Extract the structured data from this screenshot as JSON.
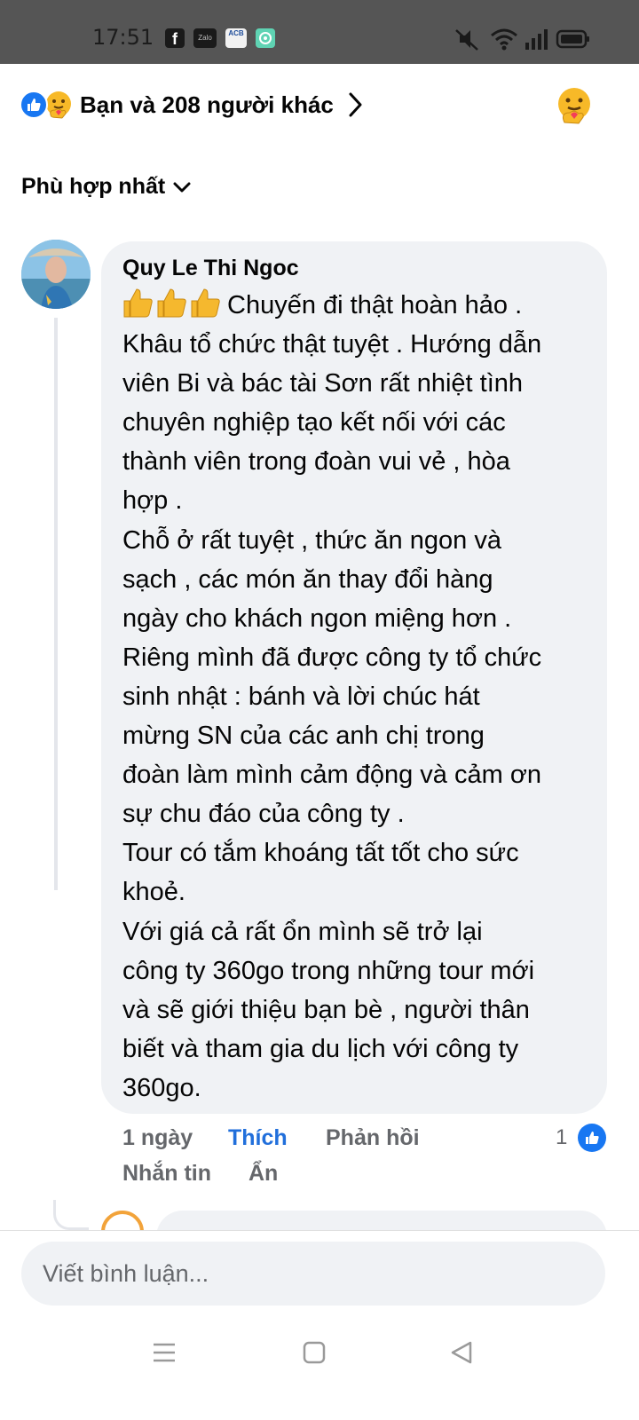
{
  "status_bar": {
    "time": "17:51",
    "apps": [
      {
        "icon": "facebook-icon",
        "label": "f"
      },
      {
        "icon": "zalo-icon",
        "label": "Zalo"
      },
      {
        "icon": "acb-icon",
        "label": "ACB"
      },
      {
        "icon": "chat-app-icon",
        "label": ""
      }
    ],
    "indicators": [
      "mute-icon",
      "wifi-icon",
      "signal-icon",
      "battery-icon"
    ]
  },
  "reactions": {
    "summary_text": "Bạn và 208 người khác",
    "types": [
      "like-icon",
      "care-icon"
    ],
    "colors": {
      "like": "#1877f2",
      "care": "#f7b928"
    }
  },
  "sort": {
    "label": "Phù hợp nhất"
  },
  "comment": {
    "author": "Quy Le Thi Ngoc",
    "emoji_prefix": "thumbs-up x3",
    "body": "Chuyến đi thật hoàn hảo .\nKhâu tổ chức thật tuyệt . Hướng dẫn\nviên Bi và bác tài Sơn rất nhiệt tình\nchuyên nghiệp tạo kết nối với các\nthành viên trong đoàn vui vẻ , hòa\nhợp .\nChỗ ở rất tuyệt , thức ăn ngon  và\nsạch , các món ăn thay đổi hàng\nngày cho khách ngon miệng hơn .\nRiêng mình đã được công ty tổ chức\nsinh nhật : bánh và lời chúc hát\nmừng  SN của các anh chị trong\nđoàn làm mình cảm động và cảm ơn\nsự chu đáo của công ty .\nTour có tắm khoáng tất tốt cho sức\nkhoẻ.\n Với giá cả rất  ổn mình sẽ  trở lại\ncông ty 360go trong những tour mới\nvà sẽ giới thiệu bạn bè , người thân\nbiết và tham gia du lịch với công ty\n360go.",
    "time_ago": "1 ngày",
    "like_action": "Thích",
    "reply_action": "Phản hồi",
    "message_action": "Nhắn tin",
    "hide_action": "Ẩn",
    "like_count": "1",
    "colors": {
      "bubble": "#f0f2f5",
      "like_action": "#216fdb",
      "meta": "#65676b"
    }
  },
  "composer": {
    "placeholder": "Viết bình luận..."
  },
  "navbar": {
    "buttons": [
      "menu-icon",
      "home-icon",
      "back-icon"
    ]
  }
}
